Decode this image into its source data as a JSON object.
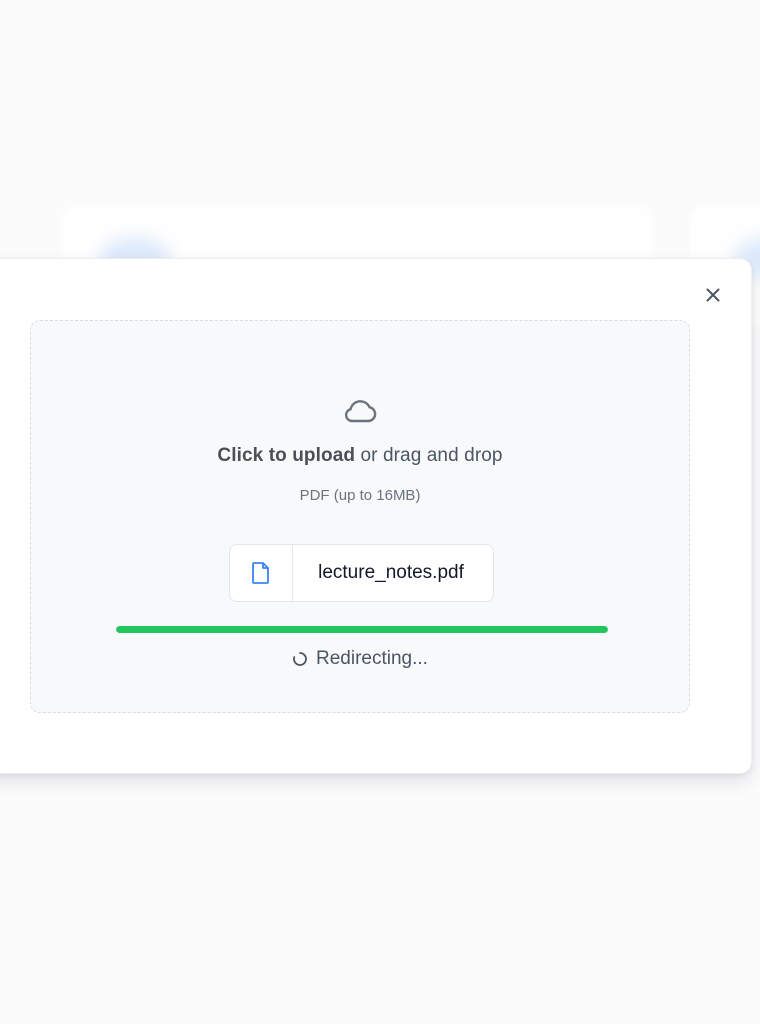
{
  "dialog": {
    "close_icon": "close-icon",
    "upload_icon": "cloud-icon",
    "headline_strong": "Click to upload",
    "headline_rest": " or drag and drop",
    "hint": "PDF (up to 16MB)",
    "file": {
      "icon": "file-icon",
      "name": "lecture_notes.pdf"
    },
    "progress": {
      "percent": 100,
      "color": "#22c55e"
    },
    "status": {
      "icon": "spinner-icon",
      "text": "Redirecting..."
    }
  },
  "colors": {
    "accent_blue": "#3b82f6",
    "progress_green": "#22c55e"
  }
}
